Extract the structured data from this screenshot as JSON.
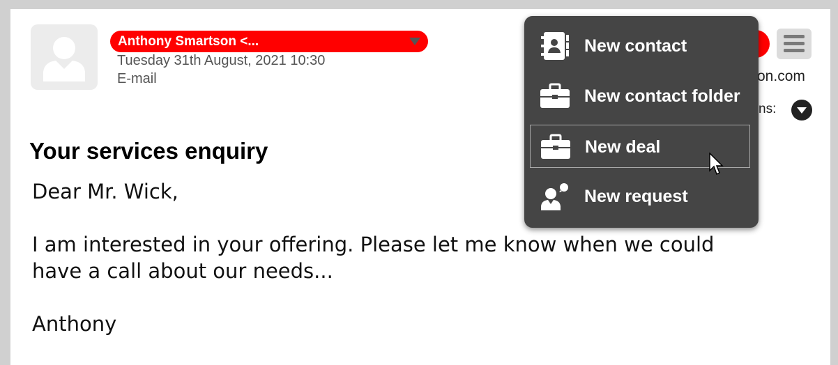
{
  "message": {
    "sender": "Anthony Smartson <...",
    "date": "Tuesday 31th August, 2021 10:30",
    "type": "E-mail",
    "email_fragment": "on.com",
    "options_fragment": "ns:",
    "subject": "Your services enquiry",
    "body": {
      "greeting": "Dear Mr. Wick,",
      "line1": "I am interested in your offering. Please let me know when we could",
      "line2": "have a call about our needs...",
      "signature": "Anthony"
    }
  },
  "dropdown": {
    "items": [
      {
        "label": "New contact",
        "icon": "address-book-icon"
      },
      {
        "label": "New contact folder",
        "icon": "briefcase-icon"
      },
      {
        "label": "New deal",
        "icon": "briefcase-icon",
        "hovered": true
      },
      {
        "label": "New request",
        "icon": "request-person-icon"
      }
    ]
  },
  "colors": {
    "accent": "#ff0000",
    "menu_bg": "#454545",
    "menu_text": "#ffffff",
    "muted_text": "#555555"
  }
}
